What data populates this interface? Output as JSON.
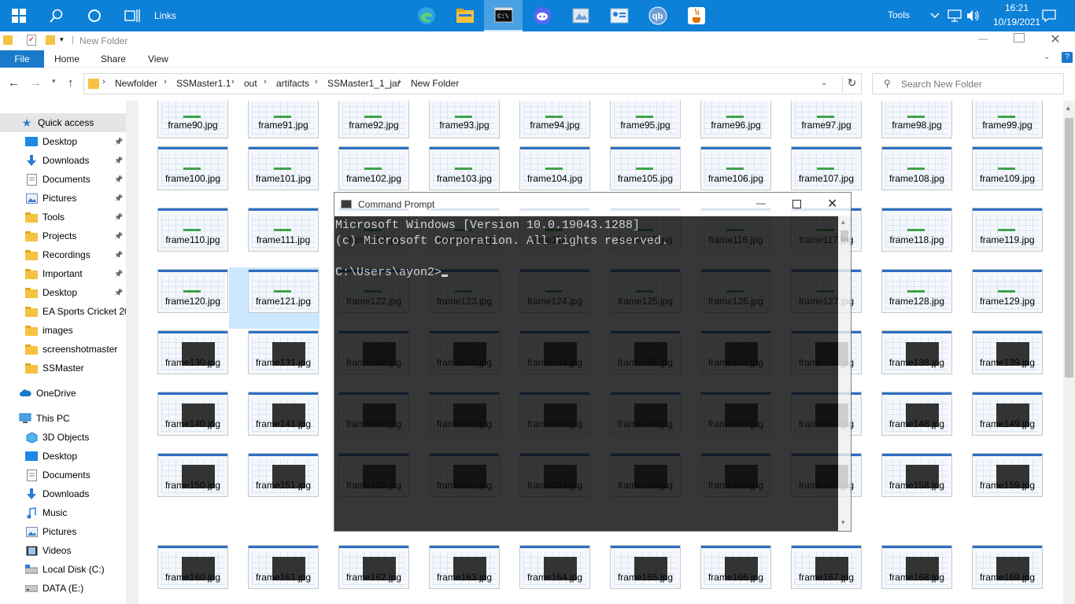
{
  "taskbar": {
    "links_label": "Links",
    "tools_label": "Tools",
    "time": "16:21",
    "date": "10/19/2021",
    "icons": [
      "windows-start-icon",
      "search-icon",
      "cortana-icon",
      "task-view-icon",
      "edge-icon",
      "file-explorer-icon",
      "command-prompt-icon",
      "discord-icon",
      "paint-icon",
      "contacts-icon",
      "qbittorrent-icon",
      "java-icon"
    ]
  },
  "explorer": {
    "title": "New Folder",
    "ribbon": {
      "file": "File",
      "home": "Home",
      "share": "Share",
      "view": "View"
    },
    "breadcrumb": [
      "Newfolder",
      "SSMaster1.1",
      "out",
      "artifacts",
      "SSMaster1_1_jar",
      "New Folder"
    ],
    "search_placeholder": "Search New Folder"
  },
  "sidebar": {
    "quick_access": "Quick access",
    "quick_items": [
      "Desktop",
      "Downloads",
      "Documents",
      "Pictures",
      "Tools",
      "Projects",
      "Recordings",
      "Important",
      "Desktop",
      "EA Sports Cricket 2007",
      "images",
      "screenshotmaster",
      "SSMaster"
    ],
    "onedrive": "OneDrive",
    "this_pc": "This PC",
    "pc_items": [
      "3D Objects",
      "Desktop",
      "Documents",
      "Downloads",
      "Music",
      "Pictures",
      "Videos",
      "Local Disk (C:)",
      "DATA (E:)"
    ]
  },
  "files": [
    [
      "frame90.jpg",
      "frame91.jpg",
      "frame92.jpg",
      "frame93.jpg",
      "frame94.jpg",
      "frame95.jpg",
      "frame96.jpg",
      "frame97.jpg",
      "frame98.jpg",
      "frame99.jpg"
    ],
    [
      "frame100.jpg",
      "frame101.jpg",
      "frame102.jpg",
      "frame103.jpg",
      "frame104.jpg",
      "frame105.jpg",
      "frame106.jpg",
      "frame107.jpg",
      "frame108.jpg",
      "frame109.jpg"
    ],
    [
      "frame110.jpg",
      "frame111.jpg",
      "frame112.jpg",
      "frame113.jpg",
      "frame114.jpg",
      "frame115.jpg",
      "frame116.jpg",
      "frame117.jpg",
      "frame118.jpg",
      "frame119.jpg"
    ],
    [
      "frame120.jpg",
      "frame121.jpg",
      "frame122.jpg",
      "frame123.jpg",
      "frame124.jpg",
      "frame125.jpg",
      "frame126.jpg",
      "frame127.jpg",
      "frame128.jpg",
      "frame129.jpg"
    ],
    [
      "frame130.jpg",
      "frame131.jpg",
      "frame132.jpg",
      "frame133.jpg",
      "frame134.jpg",
      "frame135.jpg",
      "frame136.jpg",
      "frame137.jpg",
      "frame138.jpg",
      "frame139.jpg"
    ],
    [
      "frame140.jpg",
      "frame141.jpg",
      "frame142.jpg",
      "frame143.jpg",
      "frame144.jpg",
      "frame145.jpg",
      "frame146.jpg",
      "frame147.jpg",
      "frame148.jpg",
      "frame149.jpg"
    ],
    [
      "frame150.jpg",
      "frame151.jpg",
      "frame152.jpg",
      "frame153.jpg",
      "frame154.jpg",
      "frame155.jpg",
      "frame156.jpg",
      "frame157.jpg",
      "frame158.jpg",
      "frame159.jpg"
    ],
    [
      "frame160.jpg",
      "frame161.jpg",
      "frame162.jpg",
      "frame163.jpg",
      "frame164.jpg",
      "frame165.jpg",
      "frame166.jpg",
      "frame167.jpg",
      "frame168.jpg",
      "frame169.jpg"
    ]
  ],
  "selected_file": "frame121.jpg",
  "cmd": {
    "title": "Command Prompt",
    "lines": [
      "Microsoft Windows [Version 10.0.19043.1288]",
      "(c) Microsoft Corporation. All rights reserved.",
      "",
      "C:\\Users\\ayon2>"
    ]
  },
  "colors": {
    "taskbar": "#0d80d8",
    "accent": "#1979ca",
    "selection": "#cce8ff",
    "cmd_bg": "#0c0c0c"
  }
}
